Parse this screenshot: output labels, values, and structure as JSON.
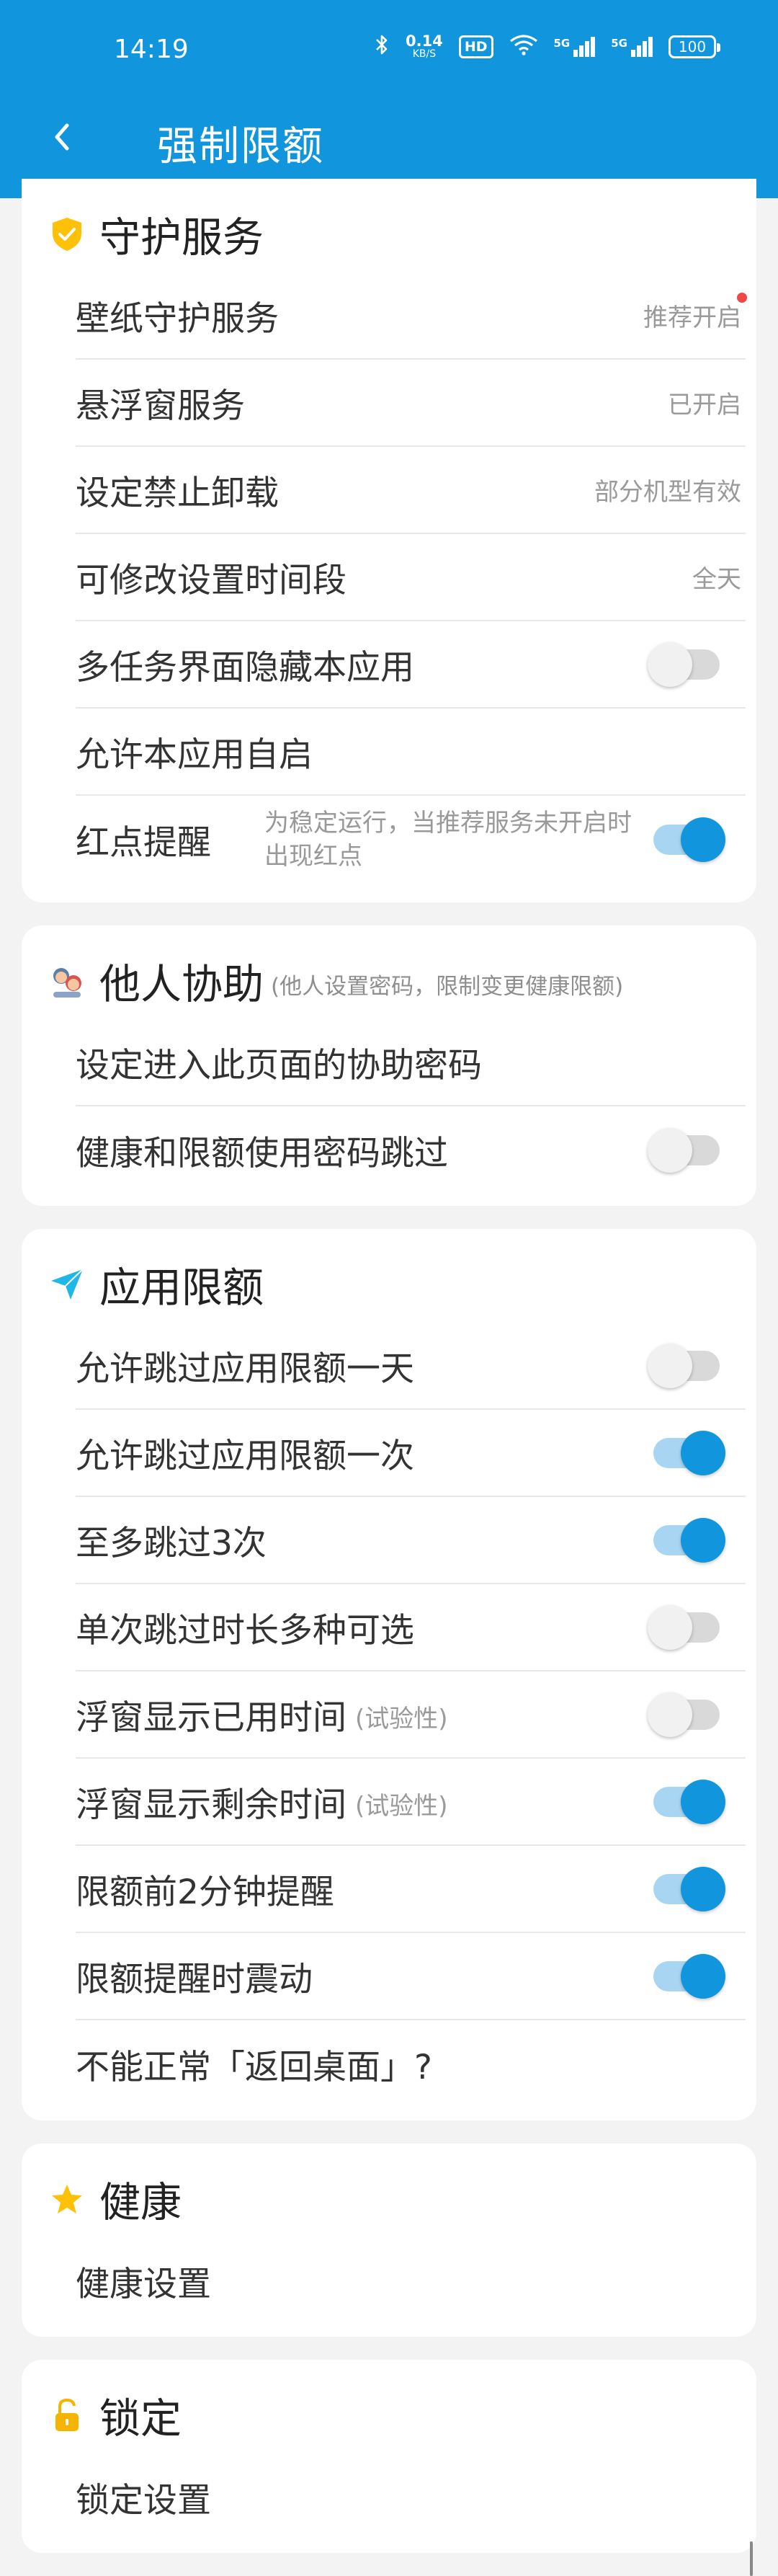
{
  "status_bar": {
    "time": "14:19",
    "net_speed_value": "0.14",
    "net_speed_unit": "KB/S",
    "hd": "HD",
    "signal1": "5G",
    "signal2": "5G",
    "battery": "100"
  },
  "header": {
    "title": "强制限额"
  },
  "guard": {
    "title": "守护服务",
    "rows": [
      {
        "label": "壁纸守护服务",
        "value": "推荐开启"
      },
      {
        "label": "悬浮窗服务",
        "value": "已开启"
      },
      {
        "label": "设定禁止卸载",
        "value": "部分机型有效"
      },
      {
        "label": "可修改设置时间段",
        "value": "全天"
      },
      {
        "label": "多任务界面隐藏本应用"
      },
      {
        "label": "允许本应用自启"
      },
      {
        "label": "红点提醒",
        "desc": "为稳定运行，当推荐服务未开启时出现红点"
      }
    ]
  },
  "assist": {
    "title": "他人协助",
    "subtitle": "(他人设置密码，限制变更健康限额)",
    "rows": [
      {
        "label": "设定进入此页面的协助密码"
      },
      {
        "label": "健康和限额使用密码跳过"
      }
    ]
  },
  "app_limit": {
    "title": "应用限额",
    "rows": [
      {
        "label": "允许跳过应用限额一天"
      },
      {
        "label": "允许跳过应用限额一次"
      },
      {
        "label": "至多跳过3次"
      },
      {
        "label": "单次跳过时长多种可选"
      },
      {
        "label": "浮窗显示已用时间",
        "tag": "(试验性)"
      },
      {
        "label": "浮窗显示剩余时间",
        "tag": "(试验性)"
      },
      {
        "label": "限额前2分钟提醒"
      },
      {
        "label": "限额提醒时震动"
      },
      {
        "label": "不能正常「返回桌面」?"
      }
    ]
  },
  "health": {
    "title": "健康",
    "rows": [
      {
        "label": "健康设置"
      }
    ]
  },
  "lock": {
    "title": "锁定",
    "rows": [
      {
        "label": "锁定设置"
      }
    ]
  },
  "toggles": {
    "hide_in_recents": false,
    "red_dot_reminder": true,
    "password_skip": false,
    "skip_one_day": false,
    "skip_once": true,
    "skip_max_3": true,
    "skip_duration_options": false,
    "float_used_time": false,
    "float_remaining_time": true,
    "remind_2min": true,
    "vibrate": true
  },
  "colors": {
    "primary": "#1195dc",
    "background": "#f3f3f3",
    "red_dot": "#f04848",
    "shield_icon": "#ffc107",
    "star_icon": "#ffc107",
    "lock_icon": "#f5b400"
  }
}
